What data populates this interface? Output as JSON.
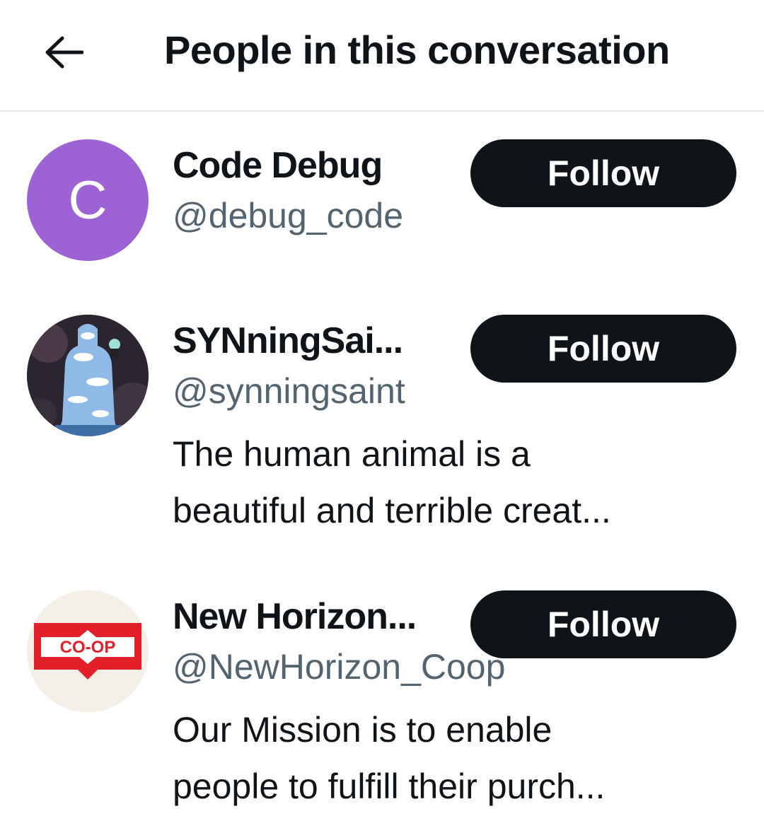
{
  "header": {
    "title": "People in this conversation",
    "back_icon": "arrow-left-icon"
  },
  "users": [
    {
      "name": "Code Debug",
      "handle": "@debug_code",
      "avatar_letter": "C",
      "avatar_color": "#9d63d4",
      "follow_label": "Follow",
      "bio": []
    },
    {
      "name": "SYNningSai...",
      "handle": "@synningsaint",
      "follow_label": "Follow",
      "bio": [
        "The human animal is a",
        "beautiful and terrible creat..."
      ]
    },
    {
      "name": "New Horizon...",
      "handle": "@NewHorizon_Coop",
      "avatar_text": "CO-OP",
      "follow_label": "Follow",
      "bio": [
        "Our Mission is to enable",
        "people to fulfill their purch..."
      ]
    }
  ],
  "colors": {
    "button_bg": "#0f1419",
    "handle_text": "#536471",
    "coop_red": "#e3202a"
  }
}
